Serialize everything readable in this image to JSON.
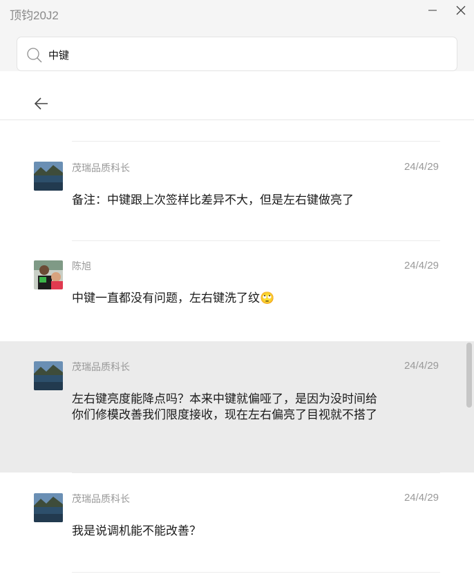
{
  "window": {
    "title": "顶钧20J2",
    "minimize_icon": "minimize-icon",
    "close_icon": "close-icon"
  },
  "search": {
    "value": "中键",
    "icon": "search-icon"
  },
  "nav": {
    "back_icon": "back-arrow-icon"
  },
  "messages": [
    {
      "sender": "茂瑞品质科长",
      "date": "24/4/29",
      "text": "备注：中键跟上次签样比差异不大，但是左右键做亮了",
      "avatar": "landscape-avatar"
    },
    {
      "sender": "陈旭",
      "date": "24/4/29",
      "text": "中键一直都没有问题，左右键洗了纹",
      "emoji": "🙄",
      "avatar": "person-avatar"
    },
    {
      "sender": "茂瑞品质科长",
      "date": "24/4/29",
      "text": "左右键亮度能降点吗？本来中键就偏哑了，是因为没时间给你们修模改善我们限度接收，现在左右偏亮了目视就不搭了",
      "avatar": "landscape-avatar",
      "highlighted": true
    },
    {
      "sender": "茂瑞品质科长",
      "date": "24/4/29",
      "text": "我是说调机能不能改善？",
      "avatar": "landscape-avatar"
    }
  ]
}
